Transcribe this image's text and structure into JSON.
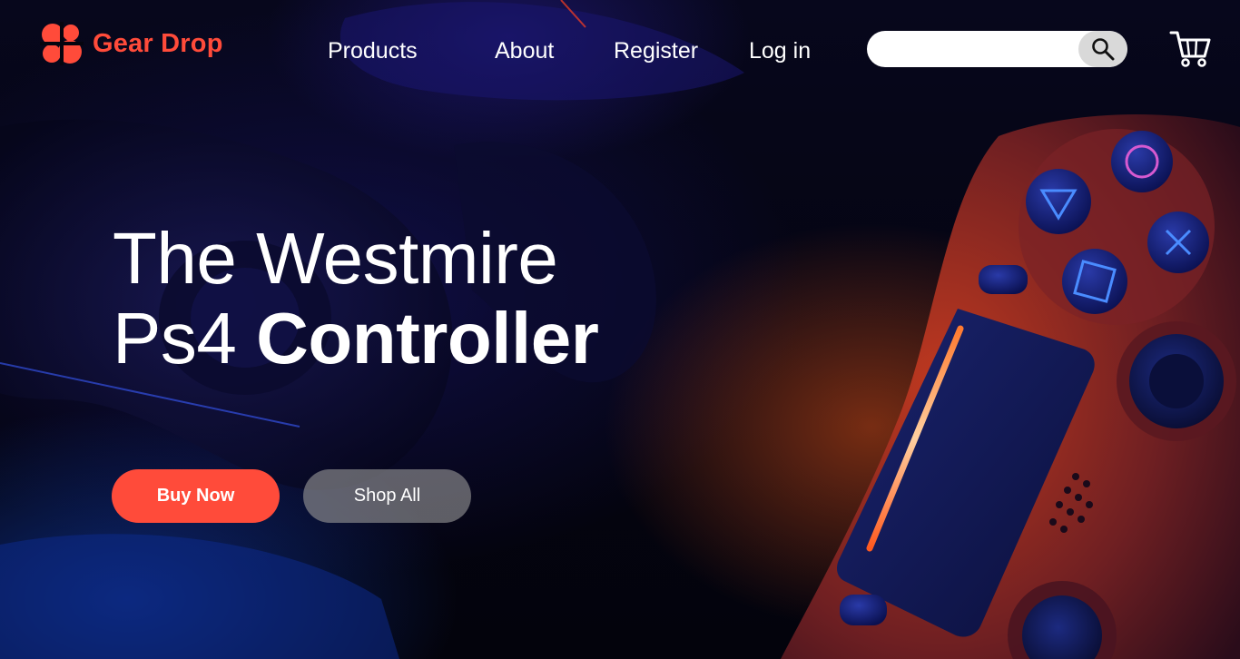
{
  "brand": {
    "name": "Gear Drop",
    "accent_color": "#ff4b3a",
    "logo_icon": "logo-mark-icon"
  },
  "nav": {
    "items": [
      {
        "label": "Products"
      },
      {
        "label": "About"
      },
      {
        "label": "Register"
      },
      {
        "label": "Log in"
      }
    ]
  },
  "search": {
    "value": "",
    "placeholder": "",
    "button_icon": "search-icon"
  },
  "cart": {
    "icon": "cart-icon"
  },
  "hero": {
    "line1": "The Westmire",
    "line2_regular": "Ps4",
    "line2_bold": "Controller",
    "background": "ps4-controller-photo"
  },
  "actions": {
    "buy_label": "Buy Now",
    "shop_label": "Shop All",
    "buy_color": "#ff4b3a",
    "shop_color": "#8f8f8f"
  }
}
